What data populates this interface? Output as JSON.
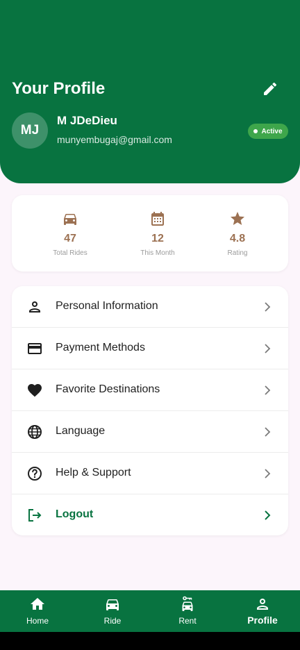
{
  "header": {
    "title": "Your Profile",
    "edit_icon": "pencil-icon",
    "avatar_initials": "MJ",
    "user_name": "M JDeDieu",
    "user_email": "munyembugaj@gmail.com",
    "status": "Active",
    "bg_color": "#087340"
  },
  "stats": [
    {
      "icon": "car-icon",
      "value": "47",
      "label": "Total Rides"
    },
    {
      "icon": "calendar-icon",
      "value": "12",
      "label": "This Month"
    },
    {
      "icon": "star-icon",
      "value": "4.8",
      "label": "Rating"
    }
  ],
  "menu": [
    {
      "icon": "person-icon",
      "label": "Personal Information"
    },
    {
      "icon": "credit-card-icon",
      "label": "Payment Methods"
    },
    {
      "icon": "heart-icon",
      "label": "Favorite Destinations"
    },
    {
      "icon": "globe-icon",
      "label": "Language"
    },
    {
      "icon": "help-icon",
      "label": "Help & Support"
    },
    {
      "icon": "logout-icon",
      "label": "Logout"
    }
  ],
  "nav": [
    {
      "icon": "home-icon",
      "label": "Home"
    },
    {
      "icon": "car-icon",
      "label": "Ride"
    },
    {
      "icon": "rent-car-icon",
      "label": "Rent"
    },
    {
      "icon": "person-icon",
      "label": "Profile",
      "active": true
    }
  ],
  "colors": {
    "primary": "#087340",
    "accent_brown": "#9c7152",
    "badge_green": "#3ea64b",
    "page_bg": "#fcf5fb"
  }
}
